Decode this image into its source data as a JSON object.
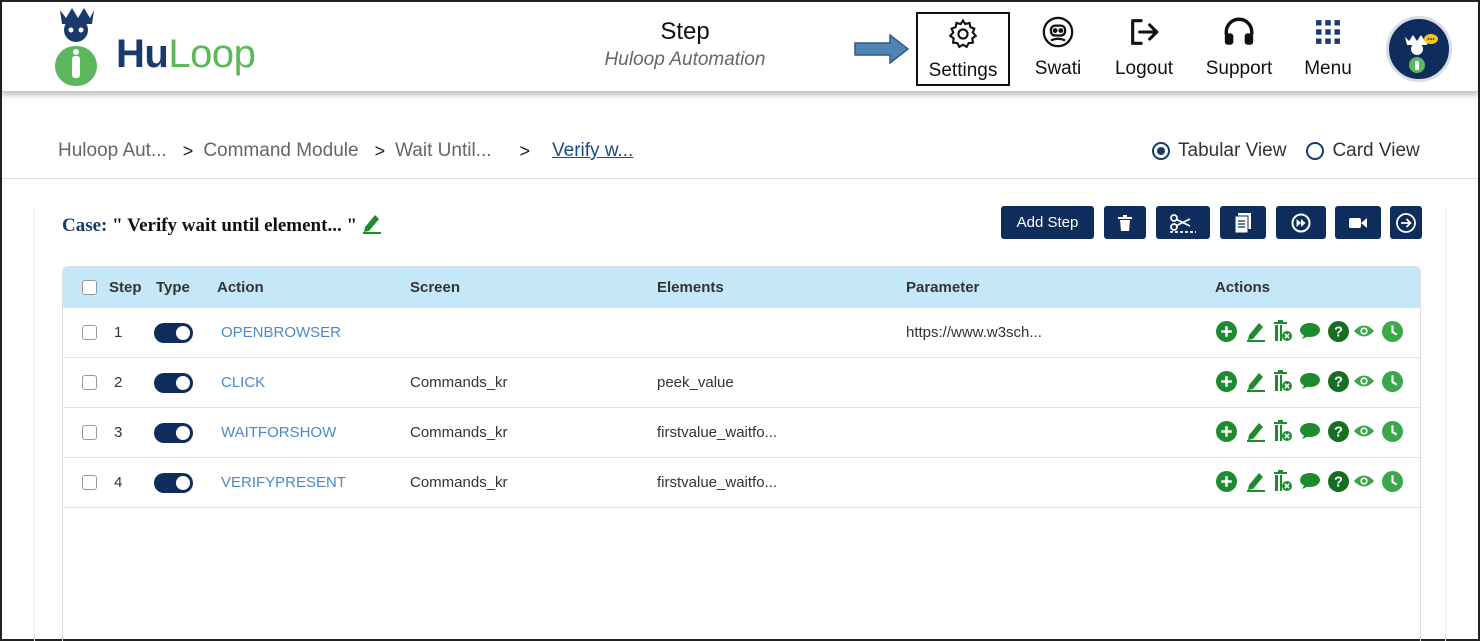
{
  "header": {
    "logo": {
      "part1": "Hu",
      "part2": "Loop"
    },
    "title": "Step",
    "subtitle": "Huloop Automation",
    "nav": {
      "settings": "Settings",
      "user": "Swati",
      "logout": "Logout",
      "support": "Support",
      "menu": "Menu"
    }
  },
  "breadcrumb": {
    "items": [
      "Huloop Aut...",
      "Command Module",
      "Wait Until..."
    ],
    "current": "Verify w..."
  },
  "views": {
    "tabular": "Tabular View",
    "card": "Card View",
    "selected": "tabular"
  },
  "case": {
    "label": "Case:",
    "title": "\" Verify wait until element... \""
  },
  "toolbar": {
    "add_step": "Add Step",
    "icons": [
      "trash-icon",
      "scissors-icon",
      "document-icon",
      "fast-forward-icon",
      "video-icon",
      "next-arrow-icon"
    ]
  },
  "table": {
    "columns": {
      "step": "Step",
      "type": "Type",
      "action": "Action",
      "screen": "Screen",
      "elements": "Elements",
      "parameter": "Parameter",
      "actions": "Actions"
    },
    "rows": [
      {
        "step": "1",
        "action": "OPENBROWSER",
        "screen": "",
        "elements": "",
        "parameter": "https://www.w3sch..."
      },
      {
        "step": "2",
        "action": "CLICK",
        "screen": "Commands_kr",
        "elements": "peek_value",
        "parameter": ""
      },
      {
        "step": "3",
        "action": "WAITFORSHOW",
        "screen": "Commands_kr",
        "elements": "firstvalue_waitfo...",
        "parameter": ""
      },
      {
        "step": "4",
        "action": "VERIFYPRESENT",
        "screen": "Commands_kr",
        "elements": "firstvalue_waitfo...",
        "parameter": ""
      }
    ],
    "row_action_icons": [
      "add-circle-icon",
      "edit-pencil-icon",
      "delete-bin-icon",
      "comment-icon",
      "help-icon",
      "view-eye-icon",
      "clock-icon"
    ]
  },
  "colors": {
    "navy": "#0f2d5c",
    "header_row": "#c5e8f9",
    "action_green": "#1e8c2e",
    "link_blue": "#4a8ac9",
    "logo_green": "#5cb85c"
  }
}
